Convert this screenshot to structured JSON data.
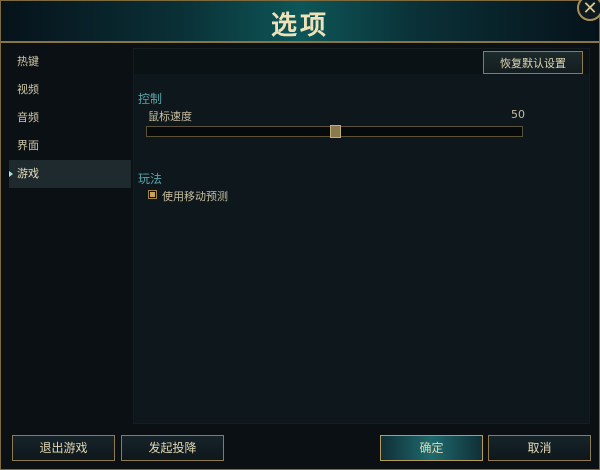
{
  "window": {
    "title": "选项",
    "close_glyph": "✕"
  },
  "sidebar": {
    "items": [
      {
        "label": "热键",
        "active": false
      },
      {
        "label": "视频",
        "active": false
      },
      {
        "label": "音频",
        "active": false
      },
      {
        "label": "界面",
        "active": false
      },
      {
        "label": "游戏",
        "active": true
      }
    ]
  },
  "content": {
    "reset_label": "恢复默认设置",
    "controls": {
      "title": "控制",
      "mouse_speed_label": "鼠标速度",
      "mouse_speed_value": "50",
      "mouse_speed_fraction": 0.5
    },
    "gameplay": {
      "title": "玩法",
      "move_prediction_label": "使用移动预测",
      "move_prediction_checked": true
    }
  },
  "footer": {
    "exit_label": "退出游戏",
    "surrender_label": "发起投降",
    "ok_label": "确定",
    "cancel_label": "取消"
  },
  "colors": {
    "accent_gold": "#a88f56",
    "accent_teal": "#5aa6a8"
  }
}
